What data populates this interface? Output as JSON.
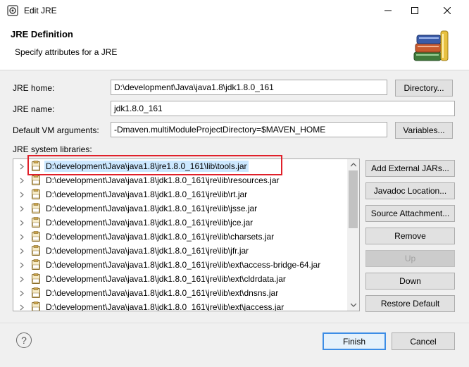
{
  "window": {
    "title": "Edit JRE",
    "close_glyph": "✕",
    "maximize_glyph": "☐",
    "minimize_glyph": "—"
  },
  "header": {
    "title": "JRE Definition",
    "subtitle": "Specify attributes for a JRE"
  },
  "fields": {
    "jre_home": {
      "label": "JRE home:",
      "value": "D:\\development\\Java\\java1.8\\jdk1.8.0_161",
      "button": "Directory..."
    },
    "jre_name": {
      "label": "JRE name:",
      "value": "jdk1.8.0_161"
    },
    "vm_args": {
      "label": "Default VM arguments:",
      "value": "-Dmaven.multiModuleProjectDirectory=$MAVEN_HOME",
      "button": "Variables..."
    }
  },
  "libraries": {
    "label": "JRE system libraries:",
    "items": [
      "D:\\development\\Java\\java1.8\\jre1.8.0_161\\lib\\tools.jar",
      "D:\\development\\Java\\java1.8\\jdk1.8.0_161\\jre\\lib\\resources.jar",
      "D:\\development\\Java\\java1.8\\jdk1.8.0_161\\jre\\lib\\rt.jar",
      "D:\\development\\Java\\java1.8\\jdk1.8.0_161\\jre\\lib\\jsse.jar",
      "D:\\development\\Java\\java1.8\\jdk1.8.0_161\\jre\\lib\\jce.jar",
      "D:\\development\\Java\\java1.8\\jdk1.8.0_161\\jre\\lib\\charsets.jar",
      "D:\\development\\Java\\java1.8\\jdk1.8.0_161\\jre\\lib\\jfr.jar",
      "D:\\development\\Java\\java1.8\\jdk1.8.0_161\\jre\\lib\\ext\\access-bridge-64.jar",
      "D:\\development\\Java\\java1.8\\jdk1.8.0_161\\jre\\lib\\ext\\cldrdata.jar",
      "D:\\development\\Java\\java1.8\\jdk1.8.0_161\\jre\\lib\\ext\\dnsns.jar",
      "D:\\development\\Java\\java1.8\\jdk1.8.0_161\\jre\\lib\\ext\\jaccess.jar"
    ],
    "selected_index": 0,
    "jar_icon_text": "010"
  },
  "side_buttons": {
    "add_external": "Add External JARs...",
    "javadoc": "Javadoc Location...",
    "source": "Source Attachment...",
    "remove": "Remove",
    "up": "Up",
    "down": "Down",
    "restore": "Restore Default"
  },
  "footer": {
    "help": "?",
    "finish": "Finish",
    "cancel": "Cancel"
  },
  "colors": {
    "selection": "#cce8ff",
    "highlight_box": "#e0202a",
    "primary_border": "#3c8de6"
  }
}
